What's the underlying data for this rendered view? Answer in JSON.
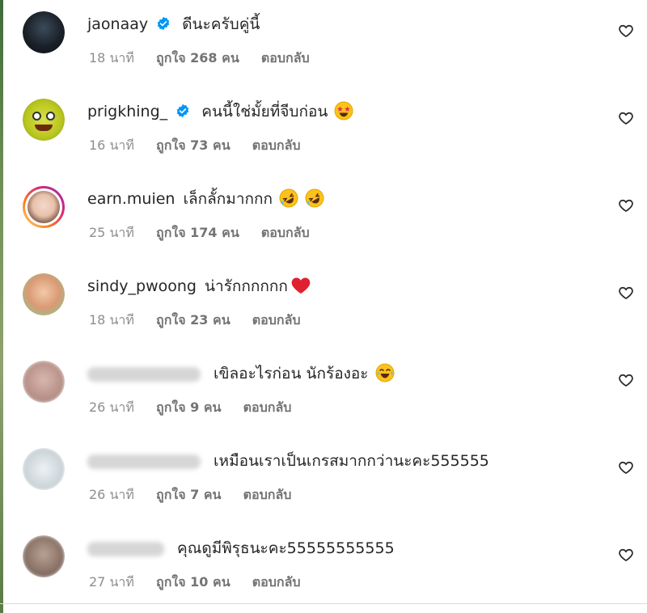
{
  "comments": [
    {
      "username": "jaonaay",
      "verified": true,
      "blurred": false,
      "text": "ดีนะครับคู่นี้",
      "emoji": "",
      "time": "18 นาที",
      "likes": "ถูกใจ 268 คน",
      "reply": "ตอบกลับ"
    },
    {
      "username": "prigkhing_",
      "verified": true,
      "blurred": false,
      "text": "คนนี้ใช่มั้ยที่จีบก่อน",
      "emoji": "star-struck-emoji",
      "time": "16 นาที",
      "likes": "ถูกใจ 73 คน",
      "reply": "ตอบกลับ"
    },
    {
      "username": "earn.muien",
      "verified": false,
      "blurred": false,
      "text": "เล็กลั้กมากกก",
      "emoji": "rolling-laughing-emoji x2",
      "time": "25 นาที",
      "likes": "ถูกใจ 174 คน",
      "reply": "ตอบกลับ"
    },
    {
      "username": "sindy_pwoong",
      "verified": false,
      "blurred": false,
      "text": "น่ารักกกกกก",
      "emoji": "red-heart-emoji",
      "time": "18 นาที",
      "likes": "ถูกใจ 23 คน",
      "reply": "ตอบกลับ"
    },
    {
      "username": "",
      "verified": false,
      "blurred": true,
      "text": "เขิลอะไรก่อน นักร้องอะ",
      "emoji": "laughing-tears-emoji",
      "time": "26 นาที",
      "likes": "ถูกใจ 9 คน",
      "reply": "ตอบกลับ"
    },
    {
      "username": "",
      "verified": false,
      "blurred": true,
      "text": "เหมือนเราเป็นเกรสมากกว่านะคะ555555",
      "emoji": "",
      "time": "26 นาที",
      "likes": "ถูกใจ 7 คน",
      "reply": "ตอบกลับ"
    },
    {
      "username": "",
      "verified": false,
      "blurred": true,
      "text": "คุณดูมีพิรุธนะคะ55555555555",
      "emoji": "",
      "time": "27 นาที",
      "likes": "ถูกใจ 10 คน",
      "reply": "ตอบกลับ"
    }
  ],
  "colors": {
    "text": "#262626",
    "meta": "#8e8e8e",
    "verified": "#0095f6",
    "divider": "#dbdbdb"
  },
  "icons": {
    "like": "heart-outline-icon",
    "verified": "verified-badge-icon"
  }
}
